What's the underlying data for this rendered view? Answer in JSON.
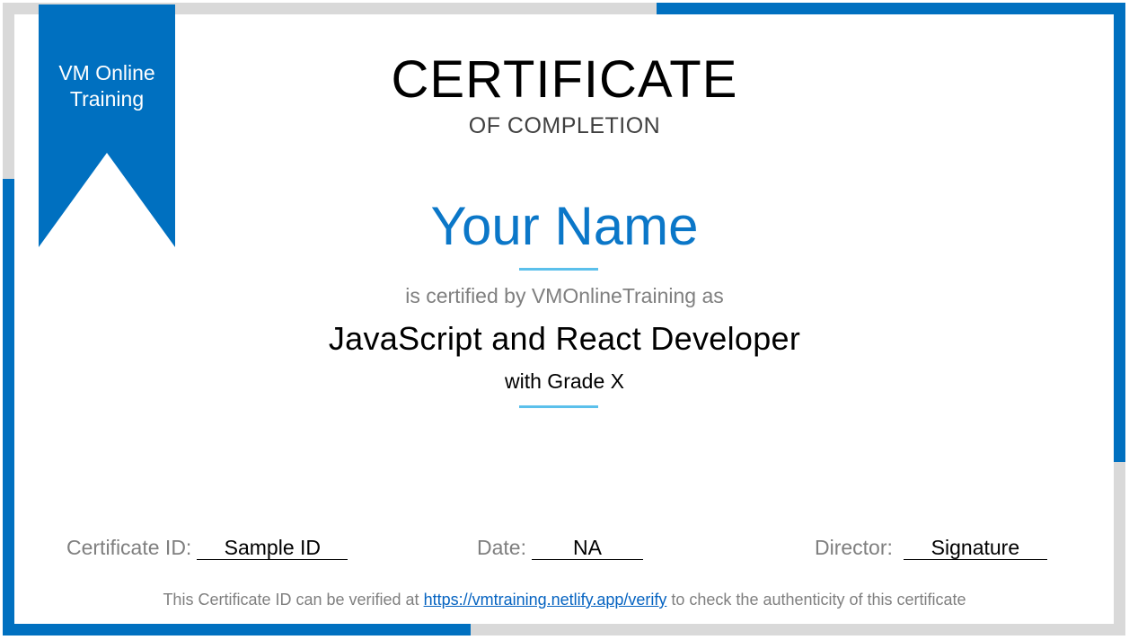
{
  "ribbon": {
    "line1": "VM Online",
    "line2": "Training"
  },
  "certificate": {
    "title": "CERTIFICATE",
    "subtitle": "OF COMPLETION",
    "recipient_name": "Your Name",
    "certified_by": "is certified by VMOnlineTraining as",
    "course": "JavaScript and React Developer",
    "grade": "with Grade X"
  },
  "footer": {
    "certificate_id_label": "Certificate ID:",
    "certificate_id_value": "Sample ID",
    "date_label": "Date:",
    "date_value": "NA",
    "director_label": "Director:",
    "director_value": "Signature",
    "verify_prefix": "This Certificate ID can be verified at",
    "verify_link": "https://vmtraining.netlify.app/verify",
    "verify_suffix": "to check the authenticity of this certificate"
  },
  "colors": {
    "frame_blue": "#0070c0",
    "frame_gray": "#d9d9d9",
    "name_blue": "#0b77c8",
    "accent_rule": "#5bc0eb"
  }
}
